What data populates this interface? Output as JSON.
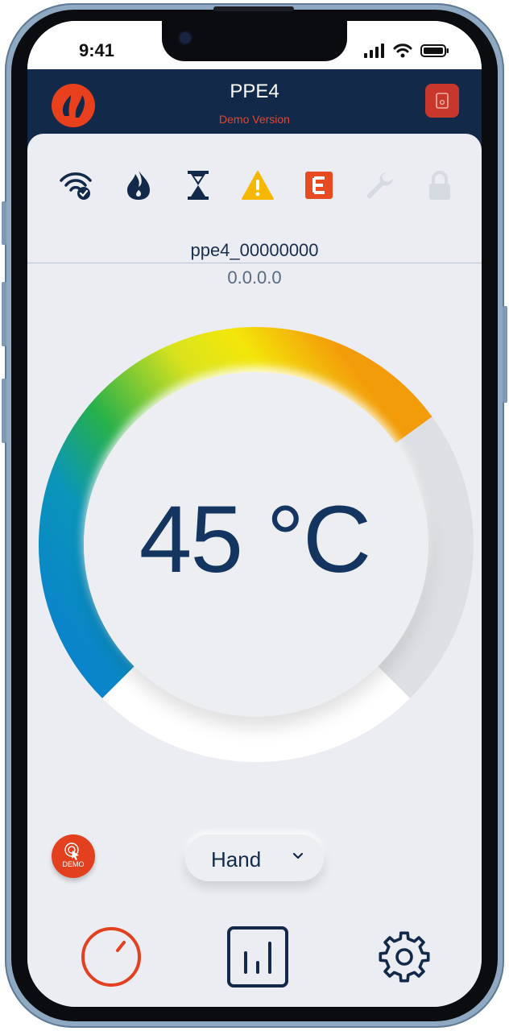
{
  "status_bar": {
    "time": "9:41"
  },
  "app_bar": {
    "title": "PPE4",
    "subtitle": "Demo Version"
  },
  "status_icons": [
    "wifi-connected-icon",
    "flame-icon",
    "hourglass-icon",
    "warning-icon",
    "error-e-icon",
    "wrench-icon",
    "lock-icon"
  ],
  "device": {
    "name": "ppe4_00000000",
    "ip": "0.0.0.0"
  },
  "gauge": {
    "temperature": "45 °C",
    "value": 45
  },
  "controls": {
    "demo_label": "DEMO",
    "mode": "Hand"
  },
  "bottom_nav": [
    "dial-icon",
    "chart-icon",
    "settings-icon"
  ],
  "colors": {
    "appbar": "#13294a",
    "accent": "#e2401e",
    "primary_text": "#13355f",
    "background": "#ebedf2"
  }
}
